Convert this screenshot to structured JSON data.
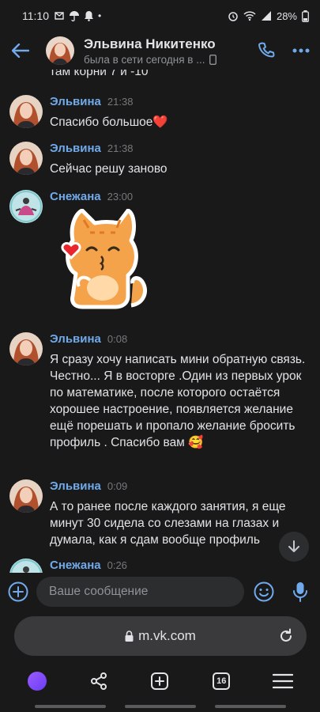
{
  "status_bar": {
    "time": "11:10",
    "battery": "28%"
  },
  "header": {
    "name": "Эльвина Никитенко",
    "status": "была в сети сегодня в ..."
  },
  "messages": {
    "cut_top_text": "там корни 7 и -10",
    "items": [
      {
        "author": "Эльвина",
        "time": "21:38",
        "text": "Спасибо большое❤️"
      },
      {
        "author": "Эльвина",
        "time": "21:38",
        "text": "Сейчас решу заново"
      },
      {
        "author": "Снежана",
        "time": "23:00",
        "text": ""
      },
      {
        "author": "Эльвина",
        "time": "0:08",
        "text": "Я сразу хочу написать мини обратную связь.\nЧестно... Я в восторге .Один из первых урок по математике, после которого остаётся хорошее настроение, появляется желание ещё порешать и пропало желание бросить профиль . Спасибо вам 🥰"
      },
      {
        "author": "Эльвина",
        "time": "0:09",
        "text": "А то ранее после каждого занятия, я еще минут 30 сидела со слезами на глазах и думала, как я сдам вообще профиль"
      },
      {
        "author": "Снежана",
        "time": "0:26",
        "text": ""
      }
    ]
  },
  "composer": {
    "placeholder": "Ваше сообщение"
  },
  "browser": {
    "url": "m.vk.com",
    "tabs_count": "16"
  },
  "colors": {
    "background": "#19191a",
    "accent": "#71aaeb",
    "secondary_text": "#8f9399",
    "input_bg": "#2c2d2e"
  }
}
